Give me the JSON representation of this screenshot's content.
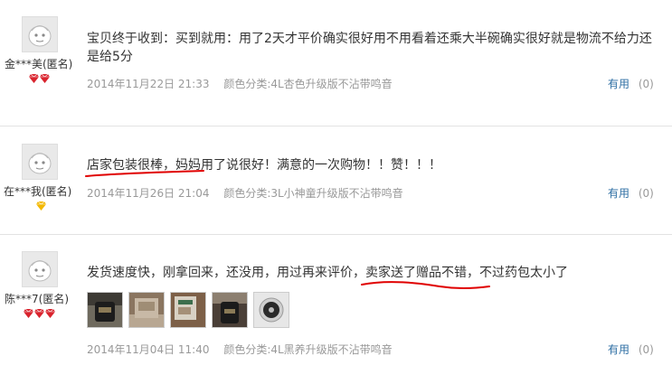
{
  "reviews": [
    {
      "user": "金***美(匿名)",
      "content": "宝贝终于收到：买到就用：用了2天才平价确实很好用不用看着还乘大半碗确实很好就是物流不给力还是给5分",
      "date": "2014年11月22日 21:33",
      "spec": "颜色分类:4L杏色升级版不沾带鸣音",
      "useful_label": "有用",
      "useful_count": "(0)",
      "badge_icon": "red-diamond-icon",
      "badge_count": 2
    },
    {
      "user": "在***我(匿名)",
      "content": "店家包装很棒，妈妈用了说很好！满意的一次购物！！赞！！！",
      "date": "2014年11月26日 21:04",
      "spec": "颜色分类:3L小神童升级版不沾带鸣音",
      "useful_label": "有用",
      "useful_count": "(0)",
      "badge_icon": "yellow-heart-icon",
      "badge_count": 1
    },
    {
      "user": "陈***7(匿名)",
      "content": "发货速度快，刚拿回来，还没用，用过再来评价，卖家送了赠品不错，不过药包太小了",
      "date": "2014年11月04日 11:40",
      "spec": "颜色分类:4L黑养升级版不沾带鸣音",
      "useful_label": "有用",
      "useful_count": "(0)",
      "badge_icon": "red-diamond-icon",
      "badge_count": 3,
      "photo_count": 5
    }
  ],
  "colors": {
    "link": "#2d6ea3",
    "meta": "#999999",
    "badge_red": "#d9232d",
    "badge_yellow": "#f3b800",
    "annotation_red": "#e00000"
  }
}
